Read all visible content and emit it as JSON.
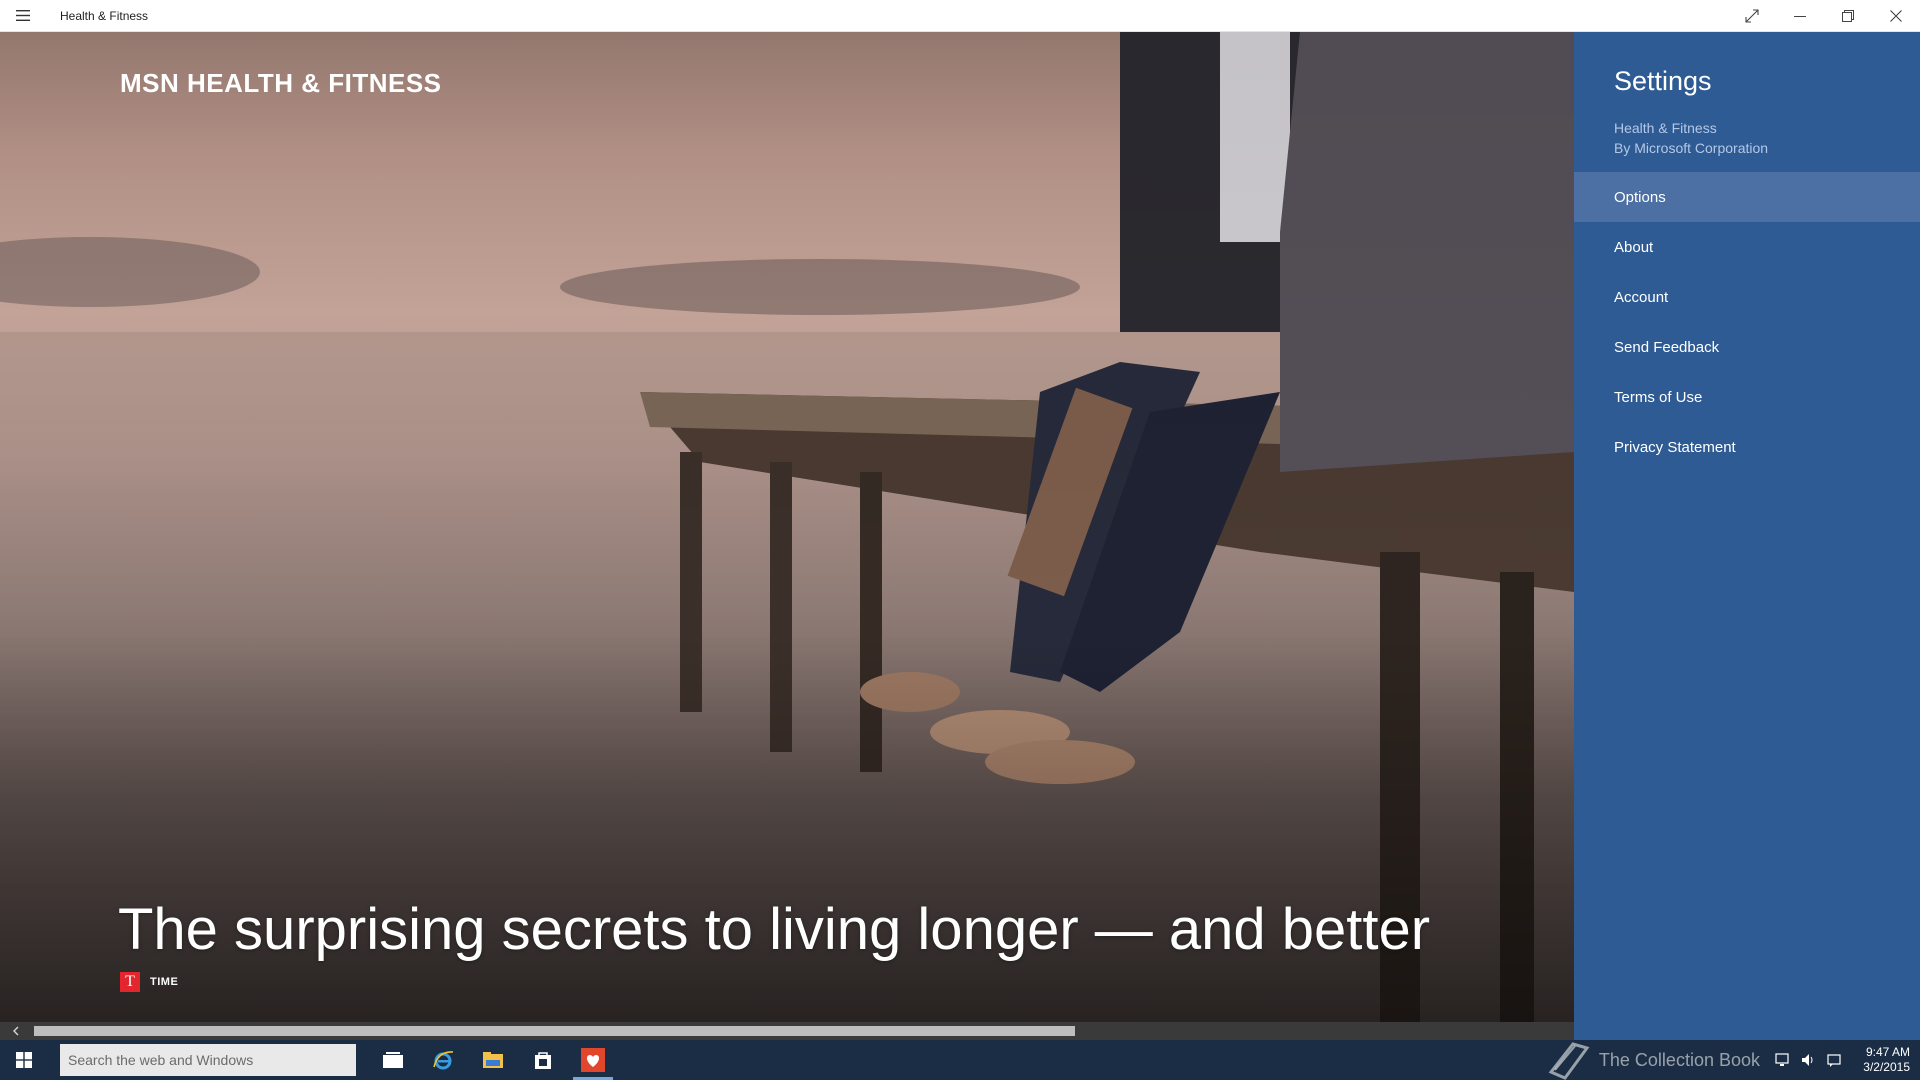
{
  "window": {
    "title": "Health & Fitness",
    "controls": [
      "fullscreen-icon",
      "minimize-icon",
      "restore-icon",
      "close-icon"
    ]
  },
  "hero": {
    "brand": "MSN HEALTH & FITNESS",
    "headline": "The surprising secrets to living longer — and better",
    "source_logo": "T",
    "source_name": "TIME",
    "scroll_position": 0.0
  },
  "settings": {
    "title": "Settings",
    "app_name": "Health & Fitness",
    "publisher": "By Microsoft Corporation",
    "items": [
      {
        "label": "Options",
        "selected": true
      },
      {
        "label": "About",
        "selected": false
      },
      {
        "label": "Account",
        "selected": false
      },
      {
        "label": "Send Feedback",
        "selected": false
      },
      {
        "label": "Terms of Use",
        "selected": false
      },
      {
        "label": "Privacy Statement",
        "selected": false
      }
    ]
  },
  "taskbar": {
    "search_placeholder": "Search the web and Windows",
    "pinned": [
      "task-view-icon",
      "internet-explorer-icon",
      "file-explorer-icon",
      "store-icon",
      "health-fitness-icon"
    ],
    "watermark": "The Collection Book",
    "time": "9:47 AM",
    "date": "3/2/2015"
  },
  "colors": {
    "settings_bg": "#2e5b94",
    "settings_selected": "#4c6fa4",
    "taskbar_bg": "#1b2d44",
    "time_red": "#e3262e"
  }
}
